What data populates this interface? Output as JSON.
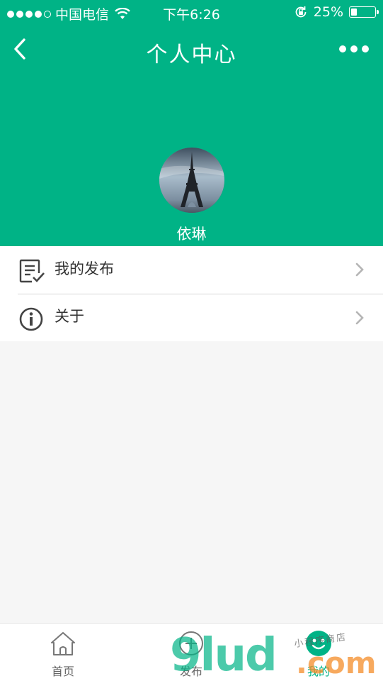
{
  "status_bar": {
    "carrier": "中国电信",
    "time": "下午6:26",
    "battery_percent": "25%",
    "battery_level": 0.25,
    "signal_bars_filled": 4,
    "signal_bars_total": 5
  },
  "header": {
    "title": "个人中心",
    "username": "依琳",
    "background_color": "#00b386"
  },
  "menu": {
    "items": [
      {
        "label": "我的发布",
        "icon": "document-check-icon"
      },
      {
        "label": "关于",
        "icon": "info-icon"
      }
    ]
  },
  "tab_bar": {
    "tabs": [
      {
        "label": "首页",
        "icon": "home-icon",
        "active": false
      },
      {
        "label": "发布",
        "icon": "publish-icon",
        "active": false
      },
      {
        "label": "我的",
        "icon": "smile-icon",
        "active": true
      }
    ],
    "active_color": "#00b386"
  },
  "watermark": {
    "main": "9lud",
    "suffix": ".com",
    "small": "小程序商店"
  }
}
